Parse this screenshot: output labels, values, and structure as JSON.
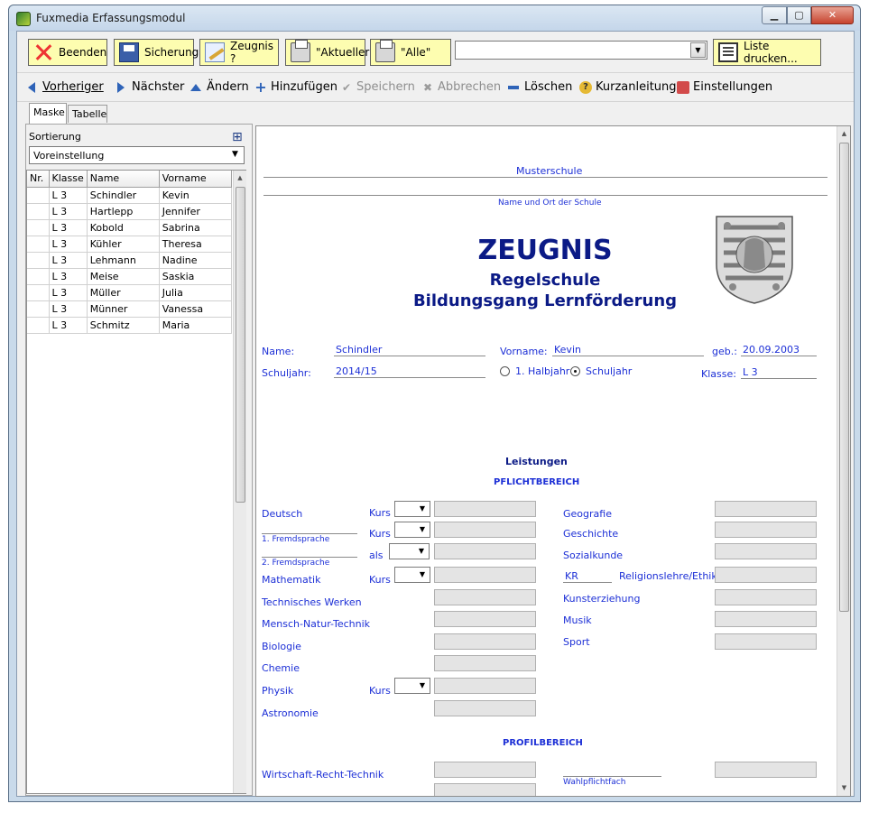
{
  "window": {
    "title": "Fuxmedia Erfassungsmodul",
    "min": "▁",
    "max": "▢",
    "close": "✕"
  },
  "toolbar1": {
    "beenden": "Beenden",
    "sicherung": "Sicherung",
    "zeugnis": "Zeugnis ?",
    "aktueller": "\"Aktueller\"",
    "alle": "\"Alle\"",
    "combo_value": "",
    "liste": "Liste drucken..."
  },
  "toolbar2": {
    "vorheriger": "Vorheriger",
    "naechster": "Nächster",
    "aendern": "Ändern",
    "hinzufuegen": "Hinzufügen",
    "speichern": "Speichern",
    "abbrechen": "Abbrechen",
    "loeschen": "Löschen",
    "kurzanleitung": "Kurzanleitung",
    "einstellungen": "Einstellungen"
  },
  "tabs": {
    "maske": "Maske",
    "tabelle": "Tabelle"
  },
  "sidebar": {
    "sortierung_label": "Sortierung",
    "sortierung_value": "Voreinstellung",
    "columns": [
      "Nr.",
      "Klasse",
      "Name",
      "Vorname"
    ],
    "rows": [
      [
        "",
        "L 3",
        "Schindler",
        "Kevin"
      ],
      [
        "",
        "L 3",
        "Hartlepp",
        "Jennifer"
      ],
      [
        "",
        "L 3",
        "Kobold",
        "Sabrina"
      ],
      [
        "",
        "L 3",
        "Kühler",
        "Theresa"
      ],
      [
        "",
        "L 3",
        "Lehmann",
        "Nadine"
      ],
      [
        "",
        "L 3",
        "Meise",
        "Saskia"
      ],
      [
        "",
        "L 3",
        "Müller",
        "Julia"
      ],
      [
        "",
        "L 3",
        "Münner",
        "Vanessa"
      ],
      [
        "",
        "L 3",
        "Schmitz",
        "Maria"
      ]
    ]
  },
  "form": {
    "school_name": "Musterschule",
    "school_caption": "Name und Ort der Schule",
    "heading": "ZEUGNIS",
    "subheading1": "Regelschule",
    "subheading2": "Bildungsgang Lernförderung",
    "name_label": "Name:",
    "name_value": "Schindler",
    "vorname_label": "Vorname:",
    "vorname_value": "Kevin",
    "geb_label": "geb.:",
    "geb_value": "20.09.2003",
    "schuljahr_label": "Schuljahr:",
    "schuljahr_value": "2014/15",
    "radio_halbjahr": "1. Halbjahr",
    "radio_schuljahr": "Schuljahr",
    "klasse_label": "Klasse:",
    "klasse_value": "L 3",
    "leistungen": "Leistungen",
    "pflichtbereich": "PFLICHTBEREICH",
    "profilbereich": "PROFILBEREICH",
    "left_subjects": {
      "deutsch": "Deutsch",
      "fremd1": "1. Fremdsprache",
      "fremd2": "2. Fremdsprache",
      "mathematik": "Mathematik",
      "tw": "Technisches Werken",
      "mnt": "Mensch-Natur-Technik",
      "biologie": "Biologie",
      "chemie": "Chemie",
      "physik": "Physik",
      "astronomie": "Astronomie",
      "wrt": "Wirtschaft-Recht-Technik"
    },
    "kurs": "Kurs",
    "als": "als",
    "right_subjects": {
      "geografie": "Geografie",
      "geschichte": "Geschichte",
      "sozialkunde": "Sozialkunde",
      "kr_value": "KR",
      "religion": "Religionslehre/Ethik *",
      "kunst": "Kunsterziehung",
      "musik": "Musik",
      "sport": "Sport",
      "wahlpflicht": "Wahlpflichtfach"
    }
  }
}
